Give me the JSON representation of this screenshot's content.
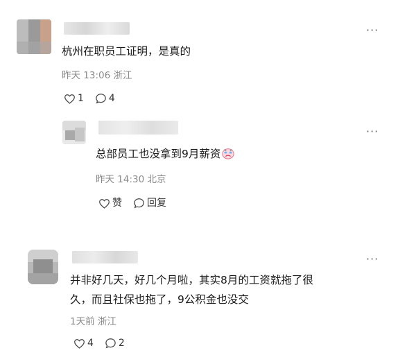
{
  "comments": [
    {
      "text": "杭州在职员工证明，是真的",
      "time": "昨天 13:06 浙江",
      "likes": "1",
      "replies": "4"
    },
    {
      "text": "总部员工也没拿到9月薪资",
      "time": "昨天 14:30 北京",
      "like_label": "赞",
      "reply_label": "回复"
    },
    {
      "text_line1": "并非好几天，好几个月啦，其实8月的工资就拖了很",
      "text_line2": "久，而且社保也拖了，9公积金也没交",
      "time": "1天前 浙江",
      "likes": "4",
      "replies": "2"
    }
  ],
  "more_label": "···"
}
